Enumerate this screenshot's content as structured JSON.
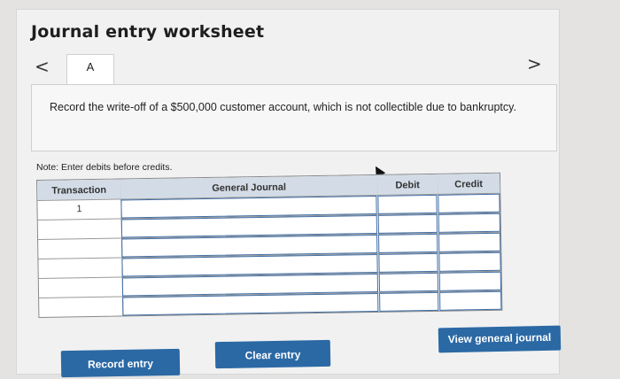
{
  "title": "Journal entry worksheet",
  "nav": {
    "prev_glyph": "<",
    "next_glyph": ">"
  },
  "tab_label": "A",
  "prompt": "Record the write-off of a $500,000 customer account, which is not collectible due to bankruptcy.",
  "note": "Note: Enter debits before credits.",
  "table": {
    "headers": [
      "Transaction",
      "General Journal",
      "Debit",
      "Credit"
    ],
    "rows": [
      {
        "transaction": "1"
      },
      {
        "transaction": ""
      },
      {
        "transaction": ""
      },
      {
        "transaction": ""
      },
      {
        "transaction": ""
      },
      {
        "transaction": ""
      }
    ]
  },
  "buttons": {
    "record": "Record entry",
    "clear": "Clear entry",
    "view": "View general journal"
  },
  "colors": {
    "button": "#2b69a5",
    "header": "#d3dce6",
    "cell_border": "#3f6da5"
  }
}
